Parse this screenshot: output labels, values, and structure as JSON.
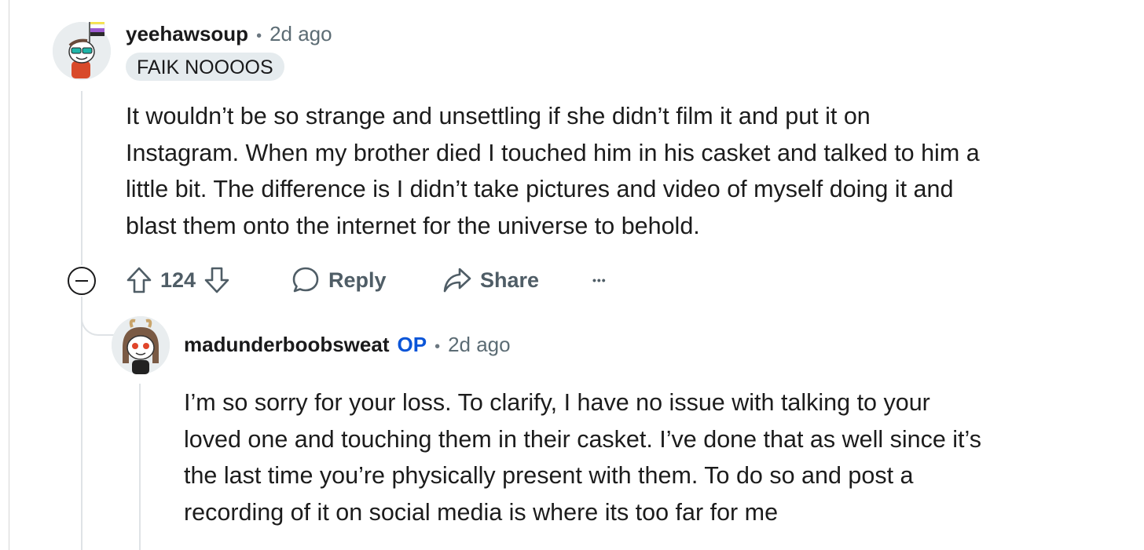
{
  "comment": {
    "username": "yeehawsoup",
    "separator": "•",
    "time": "2d ago",
    "flair": "FAIK NOOOOS",
    "body_lines": [
      "It wouldn’t be so strange and unsettling if she didn’t film it and put it on",
      "Instagram. When my brother died I touched him in his casket and talked to him a",
      "little bit. The difference is I didn’t take pictures and video of myself doing it and",
      "blast them onto the internet for the universe to behold."
    ],
    "score": "124",
    "reply_label": "Reply",
    "share_label": "Share",
    "more_label": "•••"
  },
  "reply": {
    "username": "madunderboobsweat",
    "op_badge": "OP",
    "separator": "•",
    "time": "2d ago",
    "body_lines": [
      "I’m so sorry for your loss. To clarify, I have no issue with talking to your",
      "loved one and touching them in their casket. I’ve done that as well since it’s",
      "the last time you’re physically present with them. To do so and post a",
      "recording of it on social media is where its too far for me"
    ]
  },
  "colors": {
    "accent_op": "#0a55d8",
    "meta_text": "#5c6c74",
    "action_text": "#4f5d66",
    "flair_bg": "#e5ebee",
    "thread_line": "#dfe3e6"
  },
  "icons": [
    "upvote-icon",
    "downvote-icon",
    "comment-bubble-icon",
    "share-arrow-icon",
    "more-options-icon",
    "collapse-minus-icon"
  ]
}
